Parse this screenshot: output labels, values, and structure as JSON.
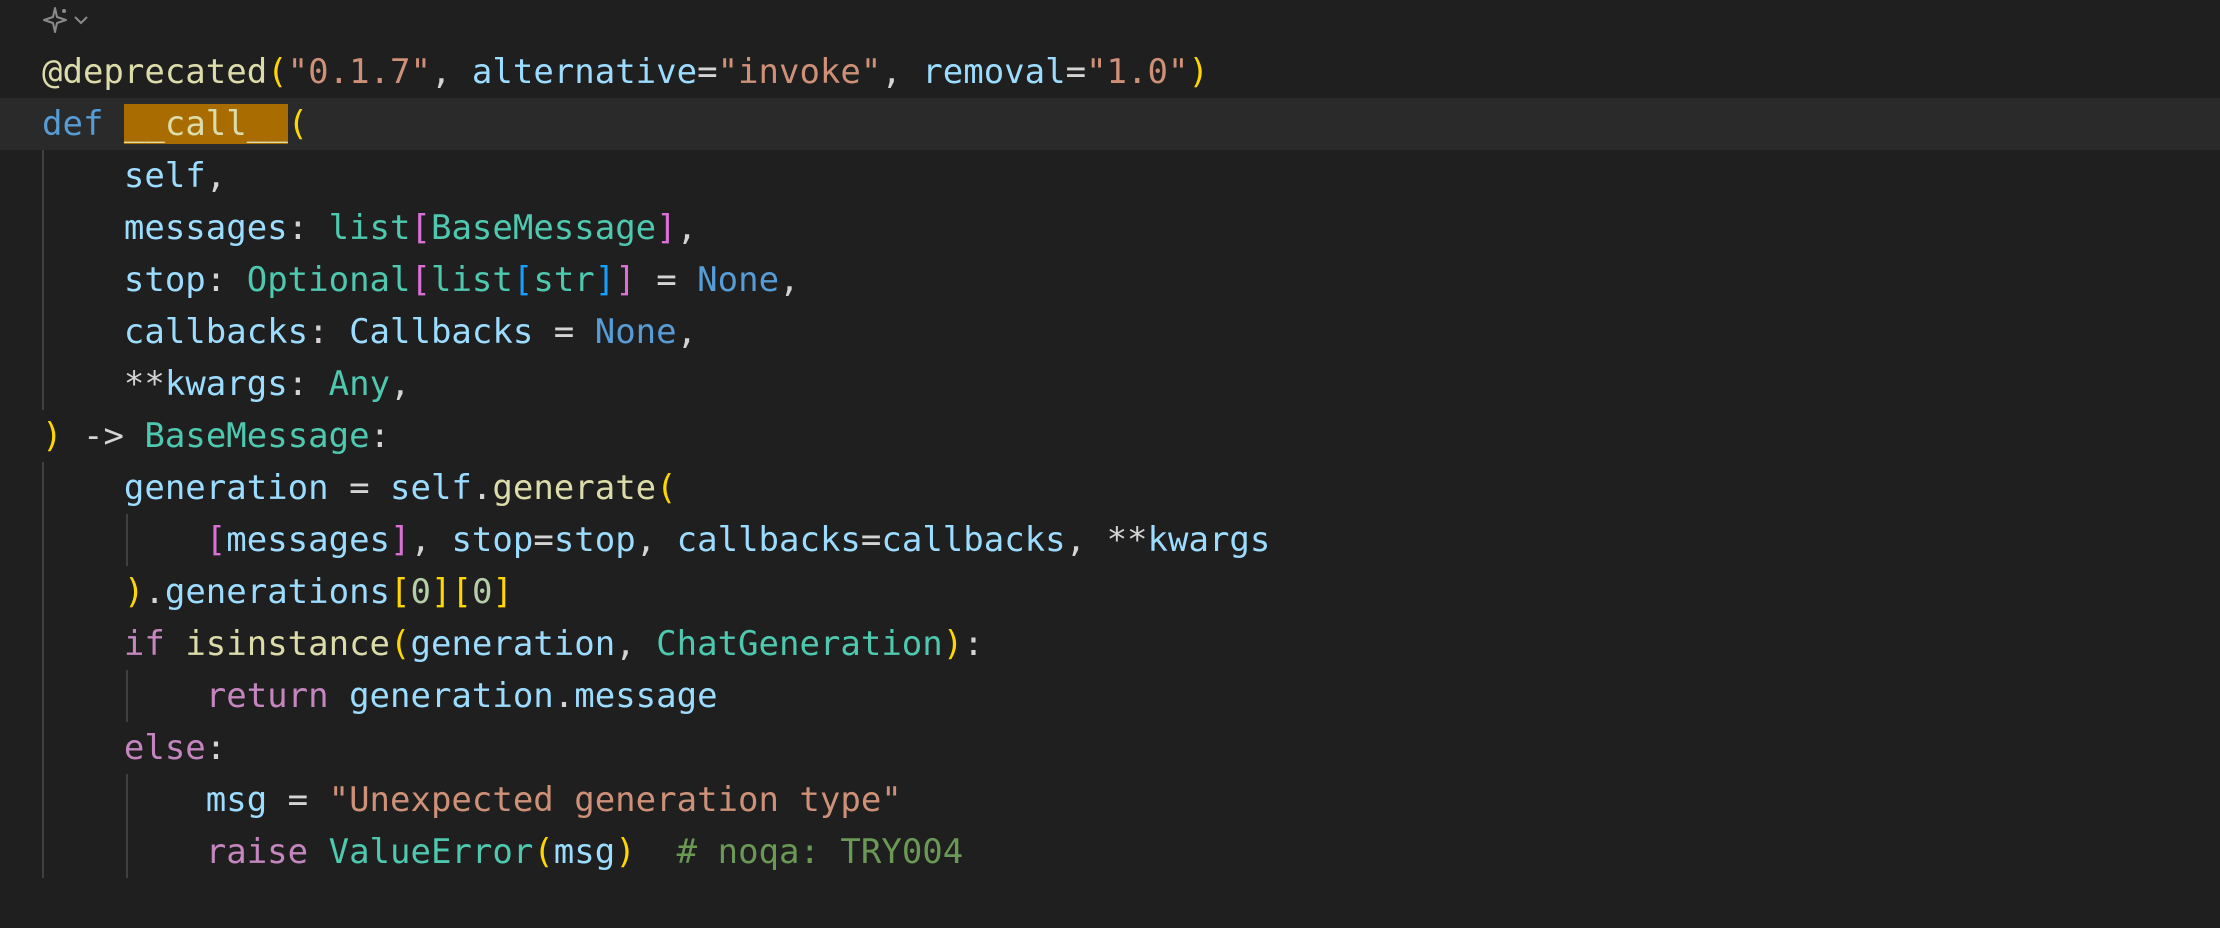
{
  "editor": {
    "language": "python",
    "toolbar_icons": [
      "sparkle-icon",
      "chevron-down-icon"
    ],
    "colors": {
      "background": "#1f1f1f",
      "current_line": "#2a2a2a",
      "selection_highlight": "#a86c00",
      "keyword": "#569cd6",
      "control": "#c586c0",
      "function": "#dcdcaa",
      "variable": "#9cdcfe",
      "type": "#4ec9b0",
      "string": "#ce9178",
      "number": "#b5cea8",
      "comment": "#6a9955",
      "bracket_1": "#ffd700",
      "bracket_2": "#da70d6",
      "bracket_3": "#179fff"
    },
    "tokens": {
      "decorator": "@deprecated",
      "deprecated_version": "\"0.1.7\"",
      "alternative_kw": "alternative",
      "alternative_val": "\"invoke\"",
      "removal_kw": "removal",
      "removal_val": "\"1.0\"",
      "def_kw": "def",
      "func_name": "__call__",
      "self_param": "self",
      "messages_param": "messages",
      "list_type": "list",
      "base_message": "BaseMessage",
      "stop_param": "stop",
      "optional_type": "Optional",
      "str_type": "str",
      "none_1": "None",
      "callbacks_param": "callbacks",
      "callbacks_type": "Callbacks",
      "none_2": "None",
      "kwargs_param": "kwargs",
      "any_type": "Any",
      "return_arrow": "->",
      "return_type": "BaseMessage",
      "generation_var": "generation",
      "self_ref": "self",
      "generate_fn": "generate",
      "messages_arg": "messages",
      "stop_kw": "stop",
      "stop_val": "stop",
      "callbacks_kw": "callbacks",
      "callbacks_val": "callbacks",
      "kwargs_arg": "kwargs",
      "generations_attr": "generations",
      "index_0a": "0",
      "index_0b": "0",
      "if_kw": "if",
      "isinstance_fn": "isinstance",
      "generation_arg": "generation",
      "chat_generation": "ChatGeneration",
      "return_kw": "return",
      "generation_ref": "generation",
      "message_attr": "message",
      "else_kw": "else",
      "msg_var": "msg",
      "error_string": "\"Unexpected generation type\"",
      "raise_kw": "raise",
      "value_error": "ValueError",
      "msg_arg": "msg",
      "noqa_comment": "# noqa: TRY004"
    }
  }
}
